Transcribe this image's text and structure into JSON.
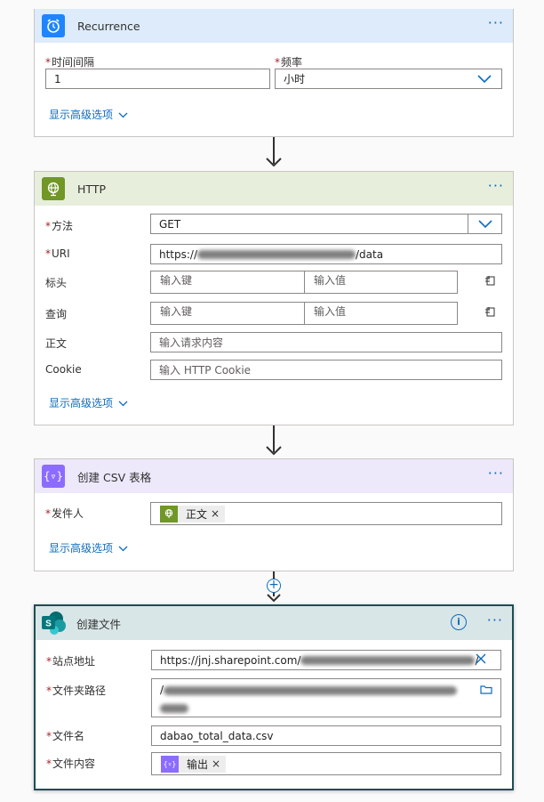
{
  "recurrence": {
    "title": "Recurrence",
    "interval_label": "时间间隔",
    "interval_value": "1",
    "frequency_label": "频率",
    "frequency_value": "小时",
    "advanced_label": "显示高级选项",
    "accent": "#1f85ff"
  },
  "http": {
    "title": "HTTP",
    "method_label": "方法",
    "method_value": "GET",
    "uri_label": "URI",
    "uri_prefix": "https://",
    "uri_suffix": "/data",
    "headers_label": "标头",
    "headers_key_placeholder": "输入键",
    "headers_value_placeholder": "输入值",
    "queries_label": "查询",
    "queries_key_placeholder": "输入键",
    "queries_value_placeholder": "输入值",
    "body_label": "正文",
    "body_placeholder": "输入请求内容",
    "cookie_label": "Cookie",
    "cookie_placeholder": "输入 HTTP Cookie",
    "advanced_label": "显示高级选项",
    "accent": "#709727"
  },
  "csv": {
    "title": "创建 CSV 表格",
    "from_label": "发件人",
    "from_token": "正文",
    "advanced_label": "显示高级选项",
    "accent": "#8c6cff"
  },
  "createfile": {
    "title": "创建文件",
    "site_label": "站点地址",
    "site_value": "https://jnj.sharepoint.com/",
    "folder_label": "文件夹路径",
    "folder_prefix": "/",
    "filename_label": "文件名",
    "filename_value": "dabao_total_data.csv",
    "content_label": "文件内容",
    "content_token": "输出",
    "info_icon": "i",
    "accent": "#036c70"
  },
  "more_label": "···",
  "token_close": "×"
}
